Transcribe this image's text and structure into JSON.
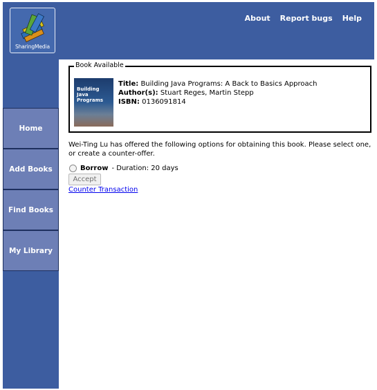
{
  "brand": {
    "name": "SharingMedia"
  },
  "top_nav": {
    "about": "About",
    "report_bugs": "Report bugs",
    "help": "Help"
  },
  "sidebar": {
    "items": [
      {
        "label": "Home"
      },
      {
        "label": "Add Books"
      },
      {
        "label": "Find Books"
      },
      {
        "label": "My Library"
      }
    ]
  },
  "book_panel": {
    "legend": "Book Available",
    "cover": {
      "title_lines": [
        "Building",
        "Java",
        "Programs"
      ]
    },
    "title_label": "Title:",
    "title_value": "Building Java Programs: A Back to Basics Approach",
    "authors_label": "Author(s):",
    "authors_value": "Stuart Reges, Martin Stepp",
    "isbn_label": "ISBN:",
    "isbn_value": "0136091814"
  },
  "message": "Wei-Ting Lu has offered the following options for obtaining this book. Please select one, or create a counter-offer.",
  "option": {
    "label": "Borrow",
    "detail": " - Duration: 20 days"
  },
  "accept_button": "Accept",
  "counter_link": "Counter Transaction",
  "colors": {
    "header_bg": "#3d5da0",
    "nav_item_bg": "#6d7fb6",
    "link": "#0000ee"
  }
}
